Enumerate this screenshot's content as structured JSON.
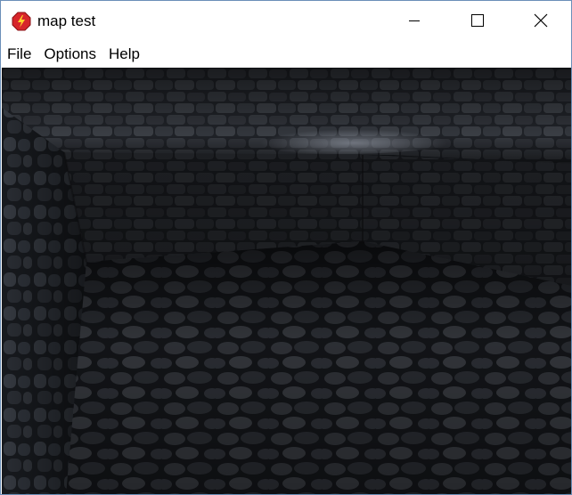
{
  "window": {
    "title": "map test",
    "icon": "red-octagon-lightning-icon",
    "controls": {
      "minimize_icon": "minimize-icon",
      "maximize_icon": "maximize-icon",
      "close_icon": "close-icon"
    }
  },
  "menubar": {
    "items": [
      {
        "label": "File"
      },
      {
        "label": "Options"
      },
      {
        "label": "Help"
      }
    ]
  },
  "scene": {
    "description_icon": "stone-dungeon-room-3d-view"
  },
  "colors": {
    "window_border": "#6b8fb8",
    "app_icon_red": "#d7262b",
    "app_icon_yellow": "#ffd42a",
    "stone_dark": "#1a1d22",
    "stone_mid": "#3a3e45",
    "stone_light": "#6c717a"
  }
}
